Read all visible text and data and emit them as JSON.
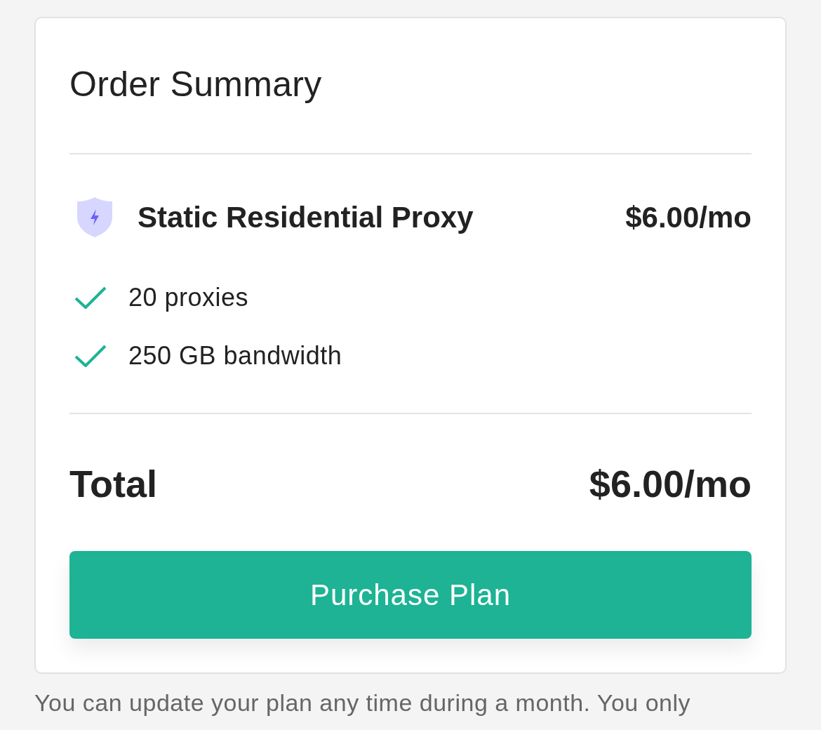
{
  "card": {
    "title": "Order Summary",
    "item": {
      "name": "Static Residential Proxy",
      "price": "$6.00/mo",
      "features": [
        "20 proxies",
        "250 GB bandwidth"
      ]
    },
    "total": {
      "label": "Total",
      "amount": "$6.00/mo"
    },
    "button": {
      "label": "Purchase Plan"
    }
  },
  "footnote": "You can update your plan any time during a month. You only"
}
